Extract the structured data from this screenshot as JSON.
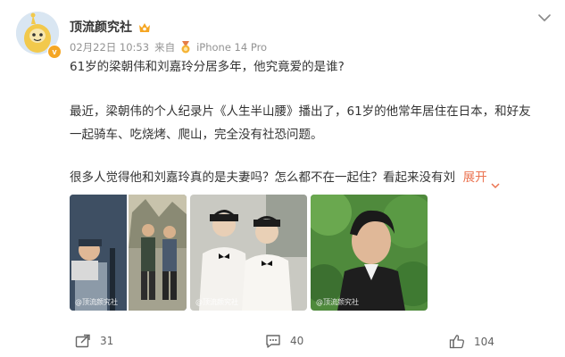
{
  "author": {
    "name": "顶流颜究社",
    "verified_badge": "v"
  },
  "meta": {
    "date": "02月22日 10:53",
    "source_prefix": "来自",
    "device": "iPhone 14 Pro"
  },
  "post": {
    "line1": "61岁的梁朝伟和刘嘉玲分居多年，他究竟爱的是谁?",
    "line2a": "最近，梁朝伟的个人纪录片《人生半山腰》播出了，61岁的他常年居住在日本，和好友",
    "line2b": "一起骑车、吃烧烤、爬山，完全没有社恐问题。",
    "line3": "很多人觉得他和刘嘉玲真的是夫妻吗？怎么都不在一起住？看起来没有刘",
    "expand_label": "展开"
  },
  "images": {
    "watermark1": "@顶流颜究社",
    "watermark2": "@顶流颜究社",
    "watermark3": "@顶流颜究社"
  },
  "actions": {
    "repost_count": "31",
    "comment_count": "40",
    "like_count": "104"
  },
  "colors": {
    "accent": "#eb7350",
    "meta_text": "#939393"
  },
  "icons": [
    "more-icon",
    "vip-icon",
    "medal-icon",
    "chevron-down-icon",
    "repost-icon",
    "comment-icon",
    "like-icon"
  ]
}
